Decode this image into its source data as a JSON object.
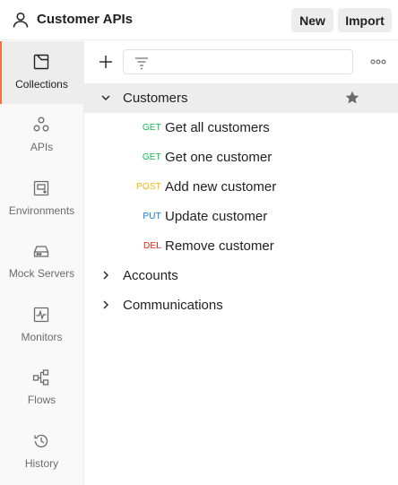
{
  "header": {
    "workspace_title": "Customer APIs",
    "new_label": "New",
    "import_label": "Import"
  },
  "sidebar": {
    "items": [
      {
        "label": "Collections",
        "icon": "collections-icon",
        "active": true
      },
      {
        "label": "APIs",
        "icon": "apis-icon"
      },
      {
        "label": "Environments",
        "icon": "environments-icon"
      },
      {
        "label": "Mock Servers",
        "icon": "mock-servers-icon"
      },
      {
        "label": "Monitors",
        "icon": "monitors-icon"
      },
      {
        "label": "Flows",
        "icon": "flows-icon"
      },
      {
        "label": "History",
        "icon": "history-icon"
      }
    ]
  },
  "toolbar": {
    "filter_value": "",
    "icons": [
      "plus-icon",
      "filter-icon",
      "more-icon"
    ]
  },
  "tree": {
    "collections": [
      {
        "name": "Customers",
        "expanded": true,
        "starred": true,
        "requests": [
          {
            "method": "GET",
            "name": "Get all customers"
          },
          {
            "method": "GET",
            "name": "Get one customer"
          },
          {
            "method": "POST",
            "name": "Add new customer"
          },
          {
            "method": "PUT",
            "name": "Update customer"
          },
          {
            "method": "DEL",
            "name": "Remove customer"
          }
        ]
      },
      {
        "name": "Accounts",
        "expanded": false
      },
      {
        "name": "Communications",
        "expanded": false
      }
    ]
  },
  "colors": {
    "accent": "#ff6c37",
    "GET": "#0cbb52",
    "POST": "#ffb400",
    "PUT": "#097bed",
    "DEL": "#eb2013"
  }
}
